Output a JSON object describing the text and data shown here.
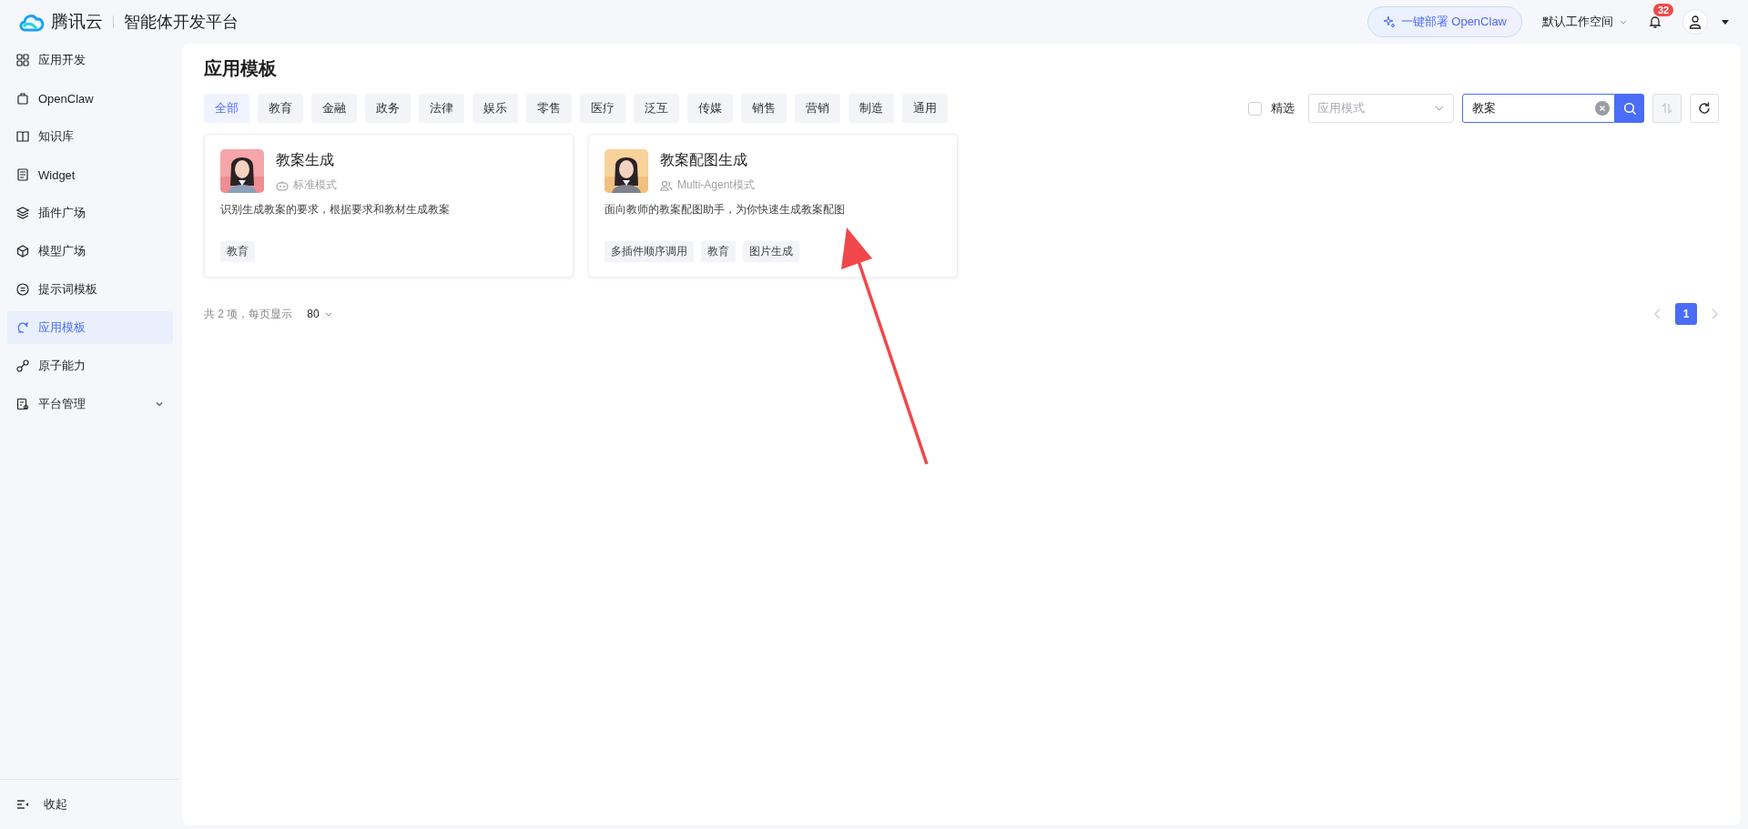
{
  "header": {
    "brand": "腾讯云",
    "product": "智能体开发平台",
    "deploy_button": "一键部署 OpenClaw",
    "workspace": "默认工作空间",
    "notification_count": "32"
  },
  "sidebar": {
    "items": [
      {
        "label": "应用开发",
        "selected": false,
        "expandable": false
      },
      {
        "label": "OpenClaw",
        "selected": false,
        "expandable": false
      },
      {
        "label": "知识库",
        "selected": false,
        "expandable": false
      },
      {
        "label": "Widget",
        "selected": false,
        "expandable": false
      },
      {
        "label": "插件广场",
        "selected": false,
        "expandable": false
      },
      {
        "label": "模型广场",
        "selected": false,
        "expandable": false
      },
      {
        "label": "提示词模板",
        "selected": false,
        "expandable": false
      },
      {
        "label": "应用模板",
        "selected": true,
        "expandable": false
      },
      {
        "label": "原子能力",
        "selected": false,
        "expandable": false
      },
      {
        "label": "平台管理",
        "selected": false,
        "expandable": true
      }
    ],
    "collapse": "收起"
  },
  "page": {
    "title": "应用模板",
    "categories": [
      {
        "label": "全部",
        "selected": true
      },
      {
        "label": "教育",
        "selected": false
      },
      {
        "label": "金融",
        "selected": false
      },
      {
        "label": "政务",
        "selected": false
      },
      {
        "label": "法律",
        "selected": false
      },
      {
        "label": "娱乐",
        "selected": false
      },
      {
        "label": "零售",
        "selected": false
      },
      {
        "label": "医疗",
        "selected": false
      },
      {
        "label": "泛互",
        "selected": false
      },
      {
        "label": "传媒",
        "selected": false
      },
      {
        "label": "销售",
        "selected": false
      },
      {
        "label": "营销",
        "selected": false
      },
      {
        "label": "制造",
        "selected": false
      },
      {
        "label": "通用",
        "selected": false
      }
    ],
    "featured": {
      "label": "精选",
      "checked": false
    },
    "mode_select": {
      "placeholder": "应用模式"
    },
    "search": {
      "value": "教案"
    },
    "sort_button": {
      "disabled": true
    },
    "cards": [
      {
        "title": "教案生成",
        "kind": "standard",
        "mode": "标准模式",
        "description": "识别生成教案的要求，根据要求和教材生成教案",
        "tags": [
          "教育"
        ]
      },
      {
        "title": "教案配图生成",
        "kind": "multi_agent",
        "mode": "Multi-Agent模式",
        "description": "面向教师的教案配图助手，为你快速生成教案配图",
        "tags": [
          "多插件顺序调用",
          "教育",
          "图片生成"
        ]
      }
    ],
    "pagination": {
      "summary": "共 2 项，每页显示",
      "page_size": "80",
      "pages": [
        {
          "label": "1",
          "selected": true
        }
      ]
    }
  }
}
